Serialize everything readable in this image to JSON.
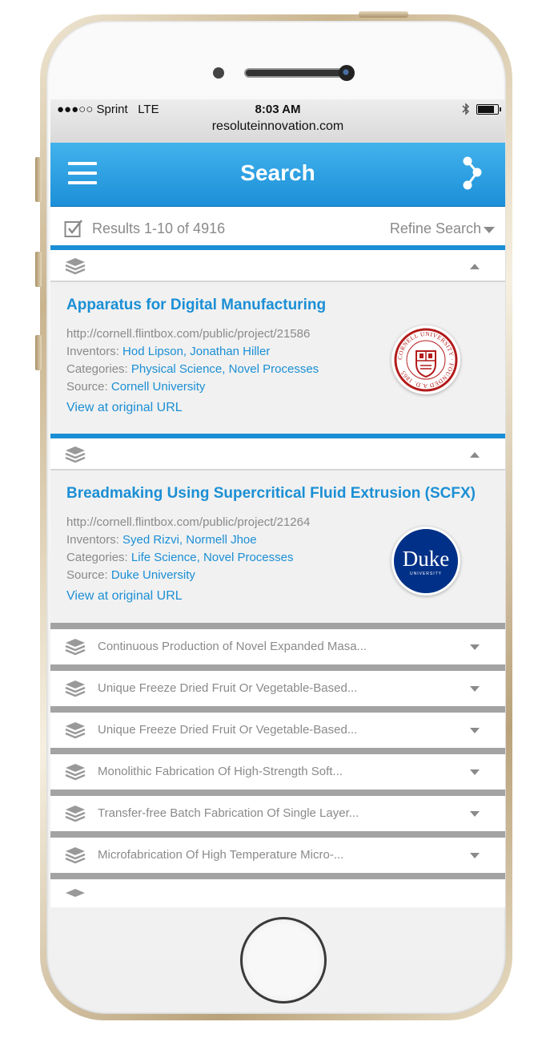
{
  "status": {
    "carrier": "Sprint",
    "network": "LTE",
    "time": "8:03 AM",
    "url": "resoluteinnovation.com"
  },
  "header": {
    "title": "Search"
  },
  "results": {
    "summary": "Results 1-10 of 4916",
    "refine_label": "Refine Search"
  },
  "expanded": [
    {
      "title": "Apparatus for Digital Manufacturing",
      "url": "http://cornell.flintbox.com/public/project/21586",
      "inventors_label": "Inventors:",
      "inventors": "Hod Lipson, Jonathan Hiller",
      "categories_label": "Categories:",
      "categories": "Physical Science, Novel Processes",
      "source_label": "Source:",
      "source": "Cornell University",
      "link_label": "View at original URL",
      "logo_text": "CORNELL UNIVERSITY · FOUNDED A.D. 1865"
    },
    {
      "title": "Breadmaking Using Supercritical Fluid Extrusion (SCFX)",
      "url": "http://cornell.flintbox.com/public/project/21264",
      "inventors_label": "Inventors:",
      "inventors": "Syed Rizvi, Normell Jhoe",
      "categories_label": "Categories:",
      "categories": "Life Science, Novel Processes",
      "source_label": "Source:",
      "source": "Duke University",
      "link_label": "View at original URL",
      "logo_main": "Duke",
      "logo_sub": "UNIVERSITY"
    }
  ],
  "collapsed": [
    "Continuous Production of Novel Expanded Masa...",
    "Unique Freeze Dried Fruit Or Vegetable-Based...",
    "Unique Freeze Dried Fruit Or Vegetable-Based...",
    "Monolithic Fabrication Of High-Strength Soft...",
    "Transfer-free Batch Fabrication Of Single Layer...",
    "Microfabrication Of High Temperature Micro-..."
  ],
  "colors": {
    "accent": "#1b8fd5",
    "cornell_red": "#b31b1b",
    "duke_blue": "#003087"
  },
  "icons": [
    "hamburger-icon",
    "share-icon",
    "checkbox-icon",
    "layers-icon",
    "chevron-up-icon",
    "chevron-down-icon",
    "bluetooth-icon",
    "battery-icon"
  ]
}
